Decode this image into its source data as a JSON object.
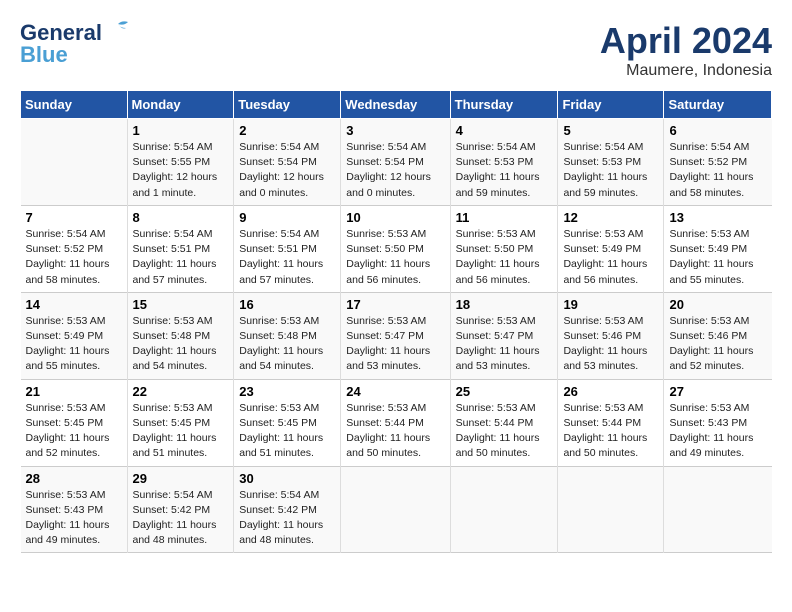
{
  "header": {
    "logo_line1": "General",
    "logo_line2": "Blue",
    "month": "April 2024",
    "location": "Maumere, Indonesia"
  },
  "weekdays": [
    "Sunday",
    "Monday",
    "Tuesday",
    "Wednesday",
    "Thursday",
    "Friday",
    "Saturday"
  ],
  "weeks": [
    [
      {
        "day": "",
        "info": ""
      },
      {
        "day": "1",
        "info": "Sunrise: 5:54 AM\nSunset: 5:55 PM\nDaylight: 12 hours\nand 1 minute."
      },
      {
        "day": "2",
        "info": "Sunrise: 5:54 AM\nSunset: 5:54 PM\nDaylight: 12 hours\nand 0 minutes."
      },
      {
        "day": "3",
        "info": "Sunrise: 5:54 AM\nSunset: 5:54 PM\nDaylight: 12 hours\nand 0 minutes."
      },
      {
        "day": "4",
        "info": "Sunrise: 5:54 AM\nSunset: 5:53 PM\nDaylight: 11 hours\nand 59 minutes."
      },
      {
        "day": "5",
        "info": "Sunrise: 5:54 AM\nSunset: 5:53 PM\nDaylight: 11 hours\nand 59 minutes."
      },
      {
        "day": "6",
        "info": "Sunrise: 5:54 AM\nSunset: 5:52 PM\nDaylight: 11 hours\nand 58 minutes."
      }
    ],
    [
      {
        "day": "7",
        "info": "Sunrise: 5:54 AM\nSunset: 5:52 PM\nDaylight: 11 hours\nand 58 minutes."
      },
      {
        "day": "8",
        "info": "Sunrise: 5:54 AM\nSunset: 5:51 PM\nDaylight: 11 hours\nand 57 minutes."
      },
      {
        "day": "9",
        "info": "Sunrise: 5:54 AM\nSunset: 5:51 PM\nDaylight: 11 hours\nand 57 minutes."
      },
      {
        "day": "10",
        "info": "Sunrise: 5:53 AM\nSunset: 5:50 PM\nDaylight: 11 hours\nand 56 minutes."
      },
      {
        "day": "11",
        "info": "Sunrise: 5:53 AM\nSunset: 5:50 PM\nDaylight: 11 hours\nand 56 minutes."
      },
      {
        "day": "12",
        "info": "Sunrise: 5:53 AM\nSunset: 5:49 PM\nDaylight: 11 hours\nand 56 minutes."
      },
      {
        "day": "13",
        "info": "Sunrise: 5:53 AM\nSunset: 5:49 PM\nDaylight: 11 hours\nand 55 minutes."
      }
    ],
    [
      {
        "day": "14",
        "info": "Sunrise: 5:53 AM\nSunset: 5:49 PM\nDaylight: 11 hours\nand 55 minutes."
      },
      {
        "day": "15",
        "info": "Sunrise: 5:53 AM\nSunset: 5:48 PM\nDaylight: 11 hours\nand 54 minutes."
      },
      {
        "day": "16",
        "info": "Sunrise: 5:53 AM\nSunset: 5:48 PM\nDaylight: 11 hours\nand 54 minutes."
      },
      {
        "day": "17",
        "info": "Sunrise: 5:53 AM\nSunset: 5:47 PM\nDaylight: 11 hours\nand 53 minutes."
      },
      {
        "day": "18",
        "info": "Sunrise: 5:53 AM\nSunset: 5:47 PM\nDaylight: 11 hours\nand 53 minutes."
      },
      {
        "day": "19",
        "info": "Sunrise: 5:53 AM\nSunset: 5:46 PM\nDaylight: 11 hours\nand 53 minutes."
      },
      {
        "day": "20",
        "info": "Sunrise: 5:53 AM\nSunset: 5:46 PM\nDaylight: 11 hours\nand 52 minutes."
      }
    ],
    [
      {
        "day": "21",
        "info": "Sunrise: 5:53 AM\nSunset: 5:45 PM\nDaylight: 11 hours\nand 52 minutes."
      },
      {
        "day": "22",
        "info": "Sunrise: 5:53 AM\nSunset: 5:45 PM\nDaylight: 11 hours\nand 51 minutes."
      },
      {
        "day": "23",
        "info": "Sunrise: 5:53 AM\nSunset: 5:45 PM\nDaylight: 11 hours\nand 51 minutes."
      },
      {
        "day": "24",
        "info": "Sunrise: 5:53 AM\nSunset: 5:44 PM\nDaylight: 11 hours\nand 50 minutes."
      },
      {
        "day": "25",
        "info": "Sunrise: 5:53 AM\nSunset: 5:44 PM\nDaylight: 11 hours\nand 50 minutes."
      },
      {
        "day": "26",
        "info": "Sunrise: 5:53 AM\nSunset: 5:44 PM\nDaylight: 11 hours\nand 50 minutes."
      },
      {
        "day": "27",
        "info": "Sunrise: 5:53 AM\nSunset: 5:43 PM\nDaylight: 11 hours\nand 49 minutes."
      }
    ],
    [
      {
        "day": "28",
        "info": "Sunrise: 5:53 AM\nSunset: 5:43 PM\nDaylight: 11 hours\nand 49 minutes."
      },
      {
        "day": "29",
        "info": "Sunrise: 5:54 AM\nSunset: 5:42 PM\nDaylight: 11 hours\nand 48 minutes."
      },
      {
        "day": "30",
        "info": "Sunrise: 5:54 AM\nSunset: 5:42 PM\nDaylight: 11 hours\nand 48 minutes."
      },
      {
        "day": "",
        "info": ""
      },
      {
        "day": "",
        "info": ""
      },
      {
        "day": "",
        "info": ""
      },
      {
        "day": "",
        "info": ""
      }
    ]
  ]
}
